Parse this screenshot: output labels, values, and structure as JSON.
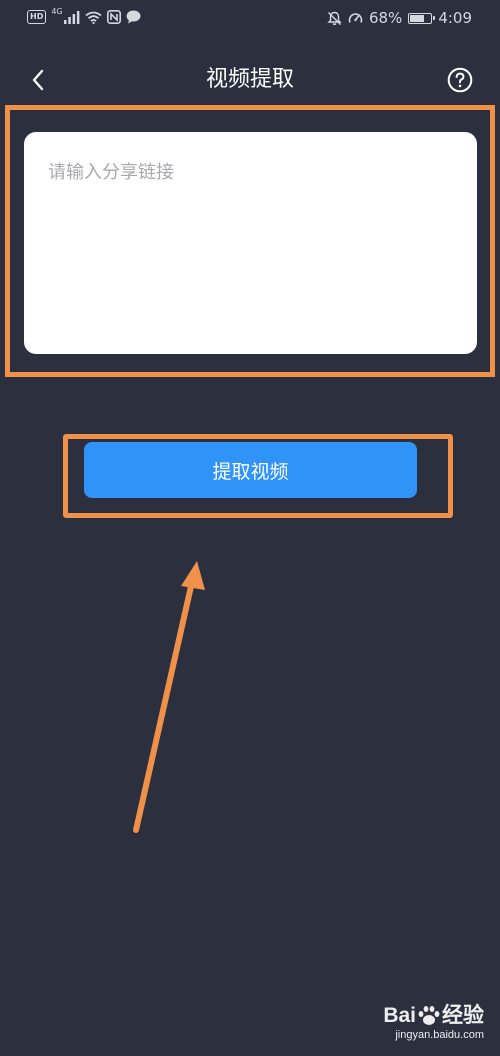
{
  "status_bar": {
    "hd_label": "HD",
    "network_label": "4G",
    "battery_percent": "68%",
    "battery_level": 0.68,
    "time": "4:09"
  },
  "header": {
    "title": "视频提取",
    "back_icon": "chevron-left-icon",
    "help_icon": "question-circle-icon"
  },
  "link_input": {
    "value": "",
    "placeholder": "请输入分享链接"
  },
  "extract_button": {
    "label": "提取视频"
  },
  "watermark": {
    "logo_text": "Bai",
    "logo_suffix": "经验",
    "site": "jingyan.baidu.com"
  },
  "colors": {
    "background": "#2b2f3e",
    "accent": "#2f93f7",
    "annotation": "#f0914a"
  }
}
